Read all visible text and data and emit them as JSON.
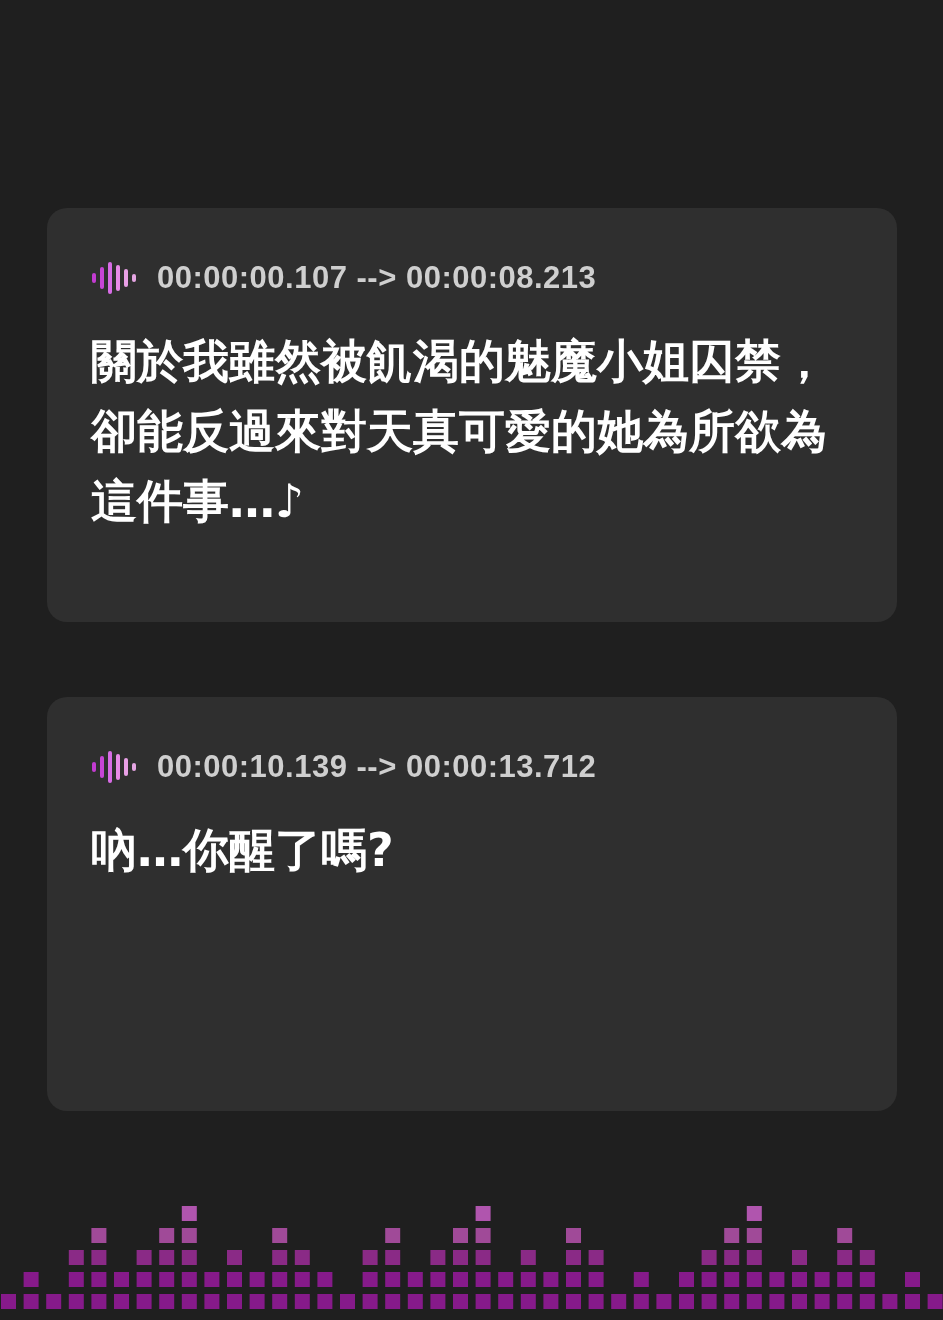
{
  "cards": [
    {
      "timestamp": "00:00:00.107 --> 00:00:08.213",
      "text": "關於我雖然被飢渴的魅魔小姐囚禁，卻能反過來對天真可愛的她為所欲為這件事…♪"
    },
    {
      "timestamp": "00:00:10.139 --> 00:00:13.712",
      "text": "吶…你醒了嗎?"
    }
  ]
}
